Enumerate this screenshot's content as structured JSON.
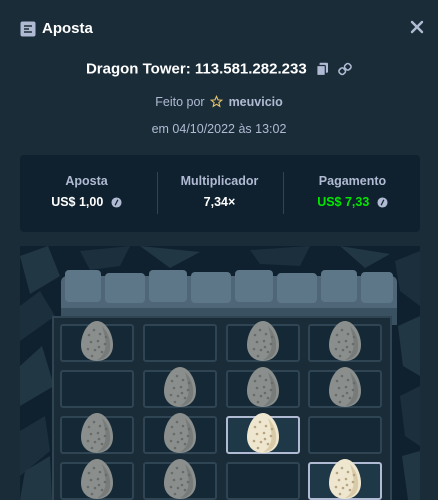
{
  "header": {
    "title": "Aposta",
    "icon": "bet-icon",
    "close_icon": "close-icon"
  },
  "game": {
    "name": "Dragon Tower:",
    "bet_id": "113.581.282.233",
    "copy_icon": "copy-icon",
    "link_icon": "link-icon"
  },
  "made_by": {
    "prefix": "Feito por",
    "user": "meuvicio",
    "icon": "star-icon"
  },
  "date": "em 04/10/2022 às 13:02",
  "stats": {
    "bet": {
      "label": "Aposta",
      "value": "US$ 1,00",
      "icon": "coin-icon"
    },
    "multiplier": {
      "label": "Multiplicador",
      "value": "7,34×"
    },
    "payout": {
      "label": "Pagamento",
      "value": "US$ 7,33",
      "icon": "coin-icon"
    }
  },
  "colors": {
    "background": "#1a2c38",
    "panel": "#0f212e",
    "muted": "#b1bad3",
    "payout": "#00e701",
    "border": "#2f4553"
  },
  "board": {
    "rows": [
      [
        "egg",
        "empty",
        "egg",
        "egg"
      ],
      [
        "empty",
        "egg",
        "egg",
        "egg"
      ],
      [
        "egg",
        "egg",
        "picked-egg",
        "empty"
      ],
      [
        "egg",
        "egg",
        "empty",
        "picked-egg"
      ]
    ]
  }
}
